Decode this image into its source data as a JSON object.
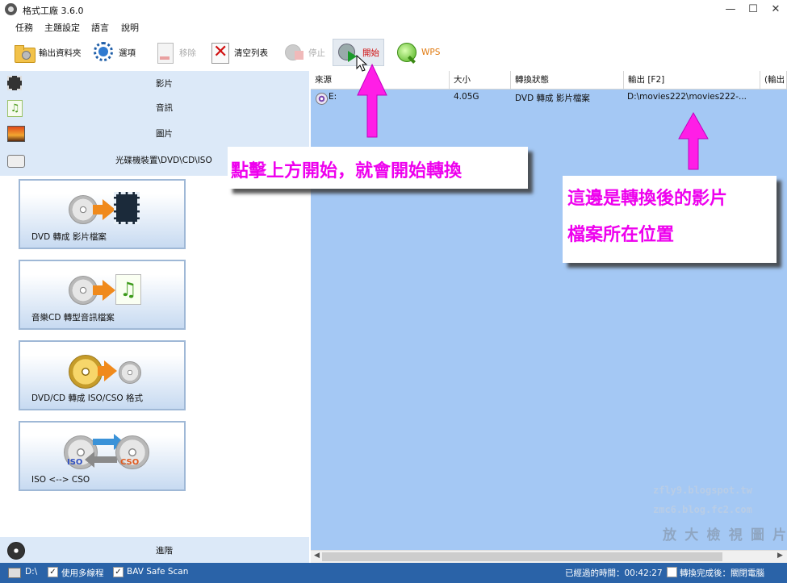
{
  "window": {
    "title": "格式工廠 3.6.0",
    "minimize": "—",
    "maximize": "☐",
    "close": "✕"
  },
  "menu": [
    "任務",
    "主題設定",
    "語言",
    "說明"
  ],
  "toolbar": {
    "output_folder": "輸出資料夾",
    "options": "選項",
    "remove": "移除",
    "clear_list": "清空列表",
    "stop": "停止",
    "start": "開始",
    "wps": "WPS"
  },
  "categories": [
    "影片",
    "音訊",
    "圖片",
    "光碟機裝置\\DVD\\CD\\ISO"
  ],
  "functions": [
    "DVD 轉成 影片檔案",
    "音樂CD 轉型音訊檔案",
    "DVD/CD 轉成 ISO/CSO 格式",
    "ISO <--> CSO"
  ],
  "iso_tags": {
    "iso": "ISO",
    "cso": "CSO"
  },
  "advanced": "進階",
  "list": {
    "headers": [
      "來源",
      "大小",
      "轉換狀態",
      "輸出 [F2]",
      "(輸出"
    ],
    "rows": [
      {
        "source": "E:",
        "size": "4.05G",
        "status": "DVD 轉成 影片檔案",
        "output": "D:\\movies222\\movies222-..."
      }
    ]
  },
  "annotations": {
    "start_note": "點擊上方開始，就會開始轉換",
    "output_note_line1": "這邊是轉換後的影片",
    "output_note_line2": "檔案所在位置"
  },
  "watermark": [
    "zfly9.blogspot.tw",
    "zmc6.blog.fc2.com",
    "放 大 檢 視 圖 片"
  ],
  "statusbar": {
    "drive": "D:\\",
    "multithread": "使用多線程",
    "bav": "BAV Safe Scan",
    "elapsed": "已經過的時間：00:42:27",
    "after_done": "轉換完成後：關閉電腦"
  },
  "colors": {
    "annotation": "#ee00ee",
    "panel": "#dce9f8",
    "list_bg": "#a4c8f4",
    "status_bg": "#2a63a8"
  }
}
